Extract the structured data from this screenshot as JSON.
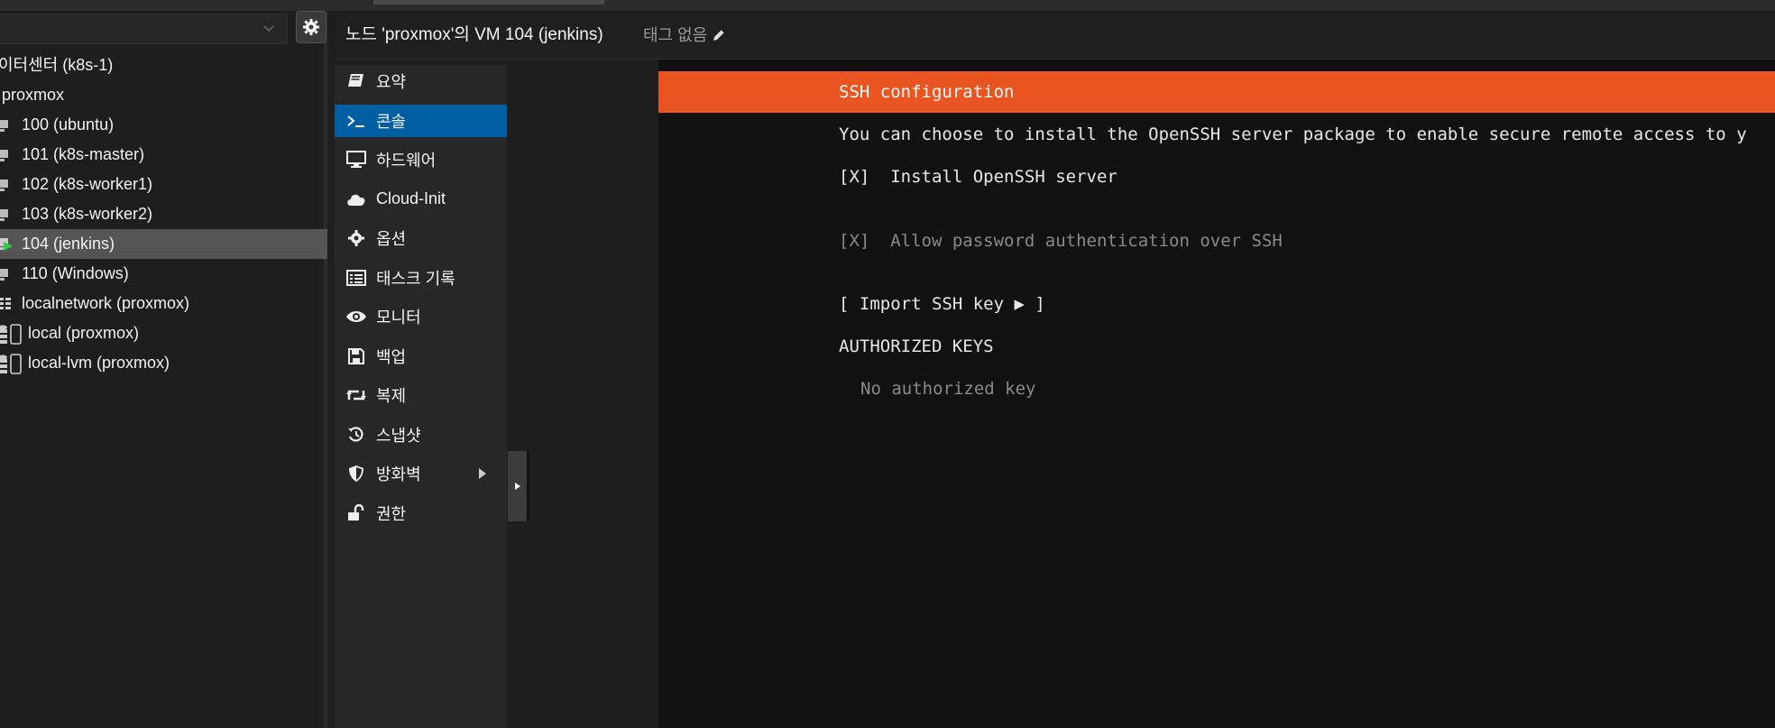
{
  "colors": {
    "accent_blue": "#005fa3",
    "console_bar": "#e95420",
    "running_green": "#2ecc40"
  },
  "tree": {
    "items": [
      {
        "label": "이터센터 (k8s-1)",
        "icon": "datacenter-icon"
      },
      {
        "label": "proxmox",
        "icon": "node-icon"
      },
      {
        "label": "100 (ubuntu)",
        "icon": "vm-icon"
      },
      {
        "label": "101 (k8s-master)",
        "icon": "vm-icon"
      },
      {
        "label": "102 (k8s-worker1)",
        "icon": "vm-icon"
      },
      {
        "label": "103 (k8s-worker2)",
        "icon": "vm-icon"
      },
      {
        "label": "104 (jenkins)",
        "icon": "vm-running-icon",
        "selected": true
      },
      {
        "label": "110 (Windows)",
        "icon": "vm-icon"
      },
      {
        "label": "localnetwork (proxmox)",
        "icon": "network-grid-icon"
      },
      {
        "label": "local (proxmox)",
        "icon": "storage-icon"
      },
      {
        "label": "local-lvm (proxmox)",
        "icon": "storage-icon"
      }
    ]
  },
  "header": {
    "title": "노드 'proxmox'의 VM 104 (jenkins)",
    "tags_label": "태그 없음"
  },
  "menu": {
    "items": [
      {
        "label": "요약",
        "icon": "book-icon"
      },
      {
        "label": "콘솔",
        "icon": "terminal-icon",
        "active": true
      },
      {
        "label": "하드웨어",
        "icon": "monitor-icon"
      },
      {
        "label": "Cloud-Init",
        "icon": "cloud-icon"
      },
      {
        "label": "옵션",
        "icon": "gear-icon"
      },
      {
        "label": "태스크 기록",
        "icon": "list-icon"
      },
      {
        "label": "모니터",
        "icon": "eye-icon"
      },
      {
        "label": "백업",
        "icon": "floppy-icon"
      },
      {
        "label": "복제",
        "icon": "retweet-icon"
      },
      {
        "label": "스냅샷",
        "icon": "history-icon"
      },
      {
        "label": "방화벽",
        "icon": "shield-icon",
        "has_submenu": true
      },
      {
        "label": "권한",
        "icon": "unlock-icon"
      }
    ]
  },
  "console": {
    "bar_title": "SSH configuration",
    "description": "You can choose to install the OpenSSH server package to enable secure remote access to y",
    "install_openssh": "[X]  Install OpenSSH server",
    "allow_password": "[X]  Allow password authentication over SSH",
    "import_key": "[ Import SSH key ▶ ]",
    "authorized_keys_heading": "AUTHORIZED KEYS",
    "no_keys": "No authorized key"
  }
}
